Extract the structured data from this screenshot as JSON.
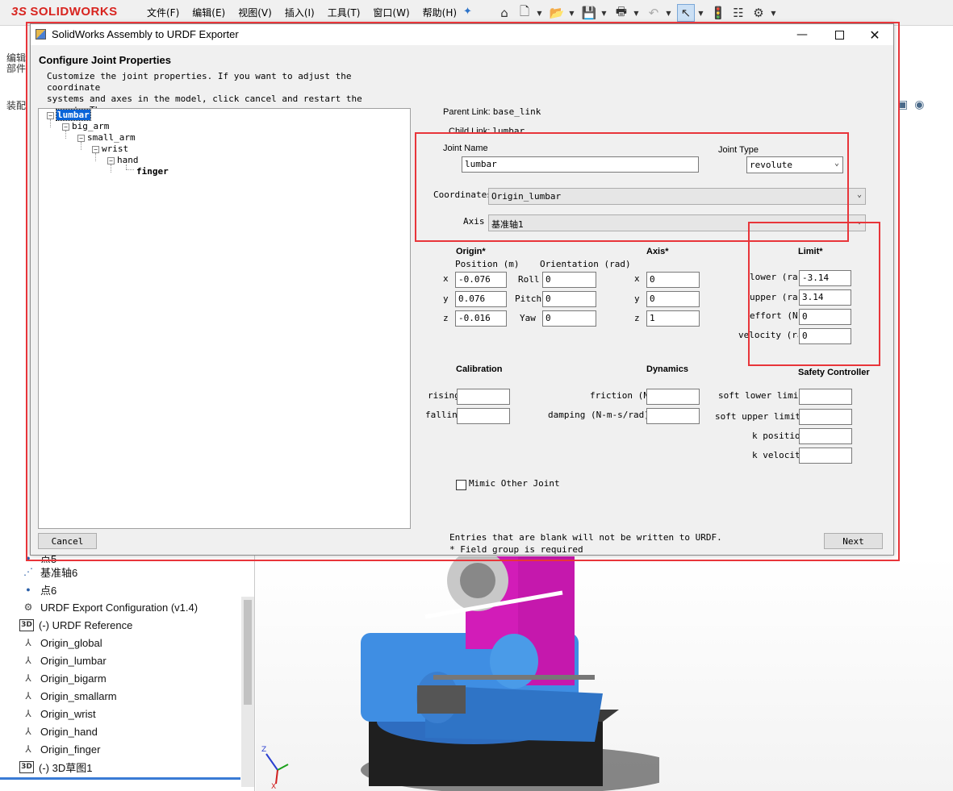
{
  "solidworks": {
    "logo_ds": "3S",
    "logo_text": "SOLIDWORKS",
    "menu": [
      "文件(F)",
      "编辑(E)",
      "视图(V)",
      "插入(I)",
      "工具(T)",
      "窗口(W)",
      "帮助(H)"
    ],
    "left_panel_cn_1": "编辑\n部件",
    "left_panel_cn_2": "装配",
    "tree_items": [
      {
        "label": "点5",
        "icon": "point-icon"
      },
      {
        "label": "基准轴6",
        "icon": "axis-icon"
      },
      {
        "label": "点6",
        "icon": "point-icon"
      },
      {
        "label": "URDF Export Configuration (v1.4)",
        "icon": "config-icon"
      },
      {
        "label": "(-) URDF Reference",
        "icon": "sketch-3d-icon"
      },
      {
        "label": "Origin_global",
        "icon": "coordinate-system-icon"
      },
      {
        "label": "Origin_lumbar",
        "icon": "coordinate-system-icon"
      },
      {
        "label": "Origin_bigarm",
        "icon": "coordinate-system-icon"
      },
      {
        "label": "Origin_smallarm",
        "icon": "coordinate-system-icon"
      },
      {
        "label": "Origin_wrist",
        "icon": "coordinate-system-icon"
      },
      {
        "label": "Origin_hand",
        "icon": "coordinate-system-icon"
      },
      {
        "label": "Origin_finger",
        "icon": "coordinate-system-icon"
      },
      {
        "label": "(-) 3D草图1",
        "icon": "sketch-3d-icon"
      }
    ],
    "triad_z": "Z",
    "triad_x": "X"
  },
  "dialog": {
    "title": "SolidWorks Assembly to URDF Exporter",
    "heading": "Configure Joint Properties",
    "description": "Customize the joint properties. If you want to adjust the coordinate\nsystems and axes in the model, click cancel and restart the export. The\ntool will recognize your changes on the next run.",
    "tree": {
      "lumbar": "lumbar",
      "big_arm": "big_arm",
      "small_arm": "small_arm",
      "wrist": "wrist",
      "hand": "hand",
      "finger": "finger"
    },
    "parent_link_label": "Parent Link:",
    "parent_link_value": "base_link",
    "child_link_label": "Child Link:",
    "child_link_value": "lumbar",
    "joint_name_label": "Joint Name",
    "joint_name_value": "lumbar",
    "joint_type_label": "Joint Type",
    "joint_type_value": "revolute",
    "coordinates_label": "Coordinates",
    "coordinates_value": "Origin_lumbar",
    "axis_label": "Axis",
    "axis_value": "基准轴1",
    "origin": {
      "title": "Origin*",
      "position_label": "Position (m)",
      "orientation_label": "Orientation (rad)",
      "x_label": "x",
      "y_label": "y",
      "z_label": "z",
      "x": "-0.076",
      "y": "0.076",
      "z": "-0.016",
      "roll_label": "Roll",
      "pitch_label": "Pitch",
      "yaw_label": "Yaw",
      "roll": "0",
      "pitch": "0",
      "yaw": "0"
    },
    "axis": {
      "title": "Axis*",
      "x_label": "x",
      "y_label": "y",
      "z_label": "z",
      "x": "0",
      "y": "0",
      "z": "1"
    },
    "limit": {
      "title": "Limit*",
      "lower_label": "lower (rad",
      "upper_label": "upper (rad",
      "effort_label": "effort (N-m",
      "velocity_label": "velocity (ra",
      "lower": "-3.14",
      "upper": "3.14",
      "effort": "0",
      "velocity": "0"
    },
    "calibration": {
      "title": "Calibration",
      "rising_label": "rising",
      "falling_label": "falling",
      "rising": "",
      "falling": ""
    },
    "dynamics": {
      "title": "Dynamics",
      "friction_label": "friction (N-",
      "damping_label": "damping (N-m-s/rad)",
      "friction": "",
      "damping": ""
    },
    "safety": {
      "title": "Safety Controller",
      "soft_lower_label": "soft lower limit",
      "soft_upper_label": "soft upper limit",
      "k_position_label": "k position",
      "k_velocity_label": "k velocity",
      "soft_lower": "",
      "soft_upper": "",
      "k_position": "",
      "k_velocity": ""
    },
    "mimic_label": "Mimic Other Joint",
    "footer_note_1": "Entries that are blank will not be written to URDF.",
    "footer_note_2": "* Field group is required",
    "cancel_label": "Cancel",
    "next_label": "Next"
  },
  "colors": {
    "highlight_red": "#e8353a",
    "selection_blue": "#0a64d8",
    "robot_blue": "#3f8ee3",
    "robot_magenta": "#d21cb8"
  }
}
